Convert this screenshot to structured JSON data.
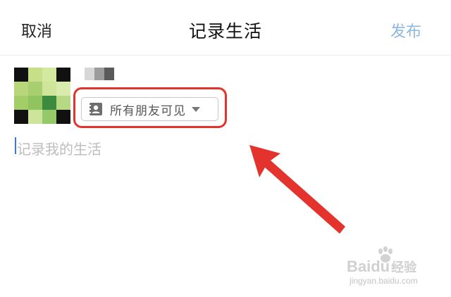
{
  "navbar": {
    "cancel_label": "取消",
    "title": "记录生活",
    "publish_label": "发布",
    "publish_color": "#8fb7de"
  },
  "avatar": {
    "mosaic_colors": [
      "#111111",
      "#c8df8a",
      "#d4e9a0",
      "#111111",
      "#b9d77a",
      "#a7cf70",
      "#cfe59a",
      "#d9ecad",
      "#a3cd66",
      "#8fc45f",
      "#3c8a3e",
      "#b7d884",
      "#111111",
      "#cde49b",
      "#95c868",
      "#111111"
    ]
  },
  "username": {
    "mosaic_colors": [
      "#d7d7d7",
      "#9c9c9c",
      "#5a5a5a"
    ]
  },
  "visibility": {
    "icon": "contacts-icon",
    "label": "所有朋友可见",
    "highlight_color": "#e4332c"
  },
  "compose": {
    "placeholder": "记录我的生活",
    "cursor_color": "#3478f6"
  },
  "annotation": {
    "arrow_color": "#e4332c"
  },
  "watermark": {
    "brand": "Baidu",
    "brand_cn": "经验",
    "site": "jingyan.baidu.com"
  }
}
